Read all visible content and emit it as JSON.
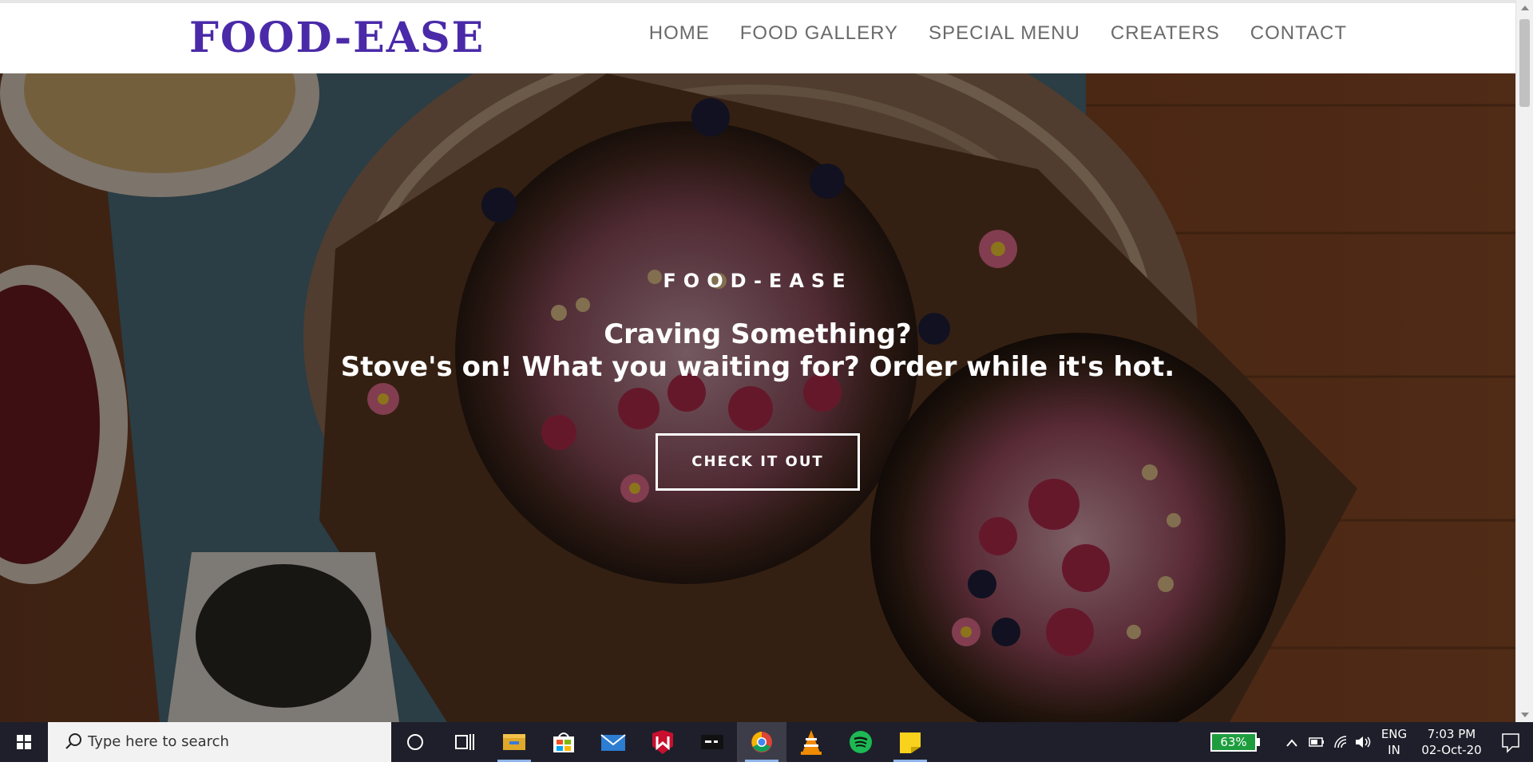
{
  "navbar": {
    "brand": "FOOD-EASE",
    "links": [
      "HOME",
      "FOOD GALLERY",
      "SPECIAL MENU",
      "CREATERS",
      "CONTACT"
    ]
  },
  "hero": {
    "kicker": "FOOD-EASE",
    "headline_1": "Craving Something?",
    "headline_2": "Stove's on! What you waiting for? Order while it's hot.",
    "cta_label": "CHECK IT OUT"
  },
  "taskbar": {
    "search_placeholder": "Type here to search",
    "battery_percent": "63%",
    "language_1": "ENG",
    "language_2": "IN",
    "time": "7:03 PM",
    "date": "02-Oct-20",
    "apps": [
      "cortana-icon",
      "task-view-icon",
      "file-explorer-icon",
      "store-icon",
      "mail-icon",
      "mcafee-icon",
      "terminal-icon",
      "chrome-icon",
      "vlc-icon",
      "spotify-icon",
      "sticky-notes-icon"
    ]
  },
  "colors": {
    "brand": "#4a2aa8",
    "nav_text": "#6a6a6a",
    "taskbar": "#1f1f2b",
    "battery": "#1e9d3e"
  }
}
